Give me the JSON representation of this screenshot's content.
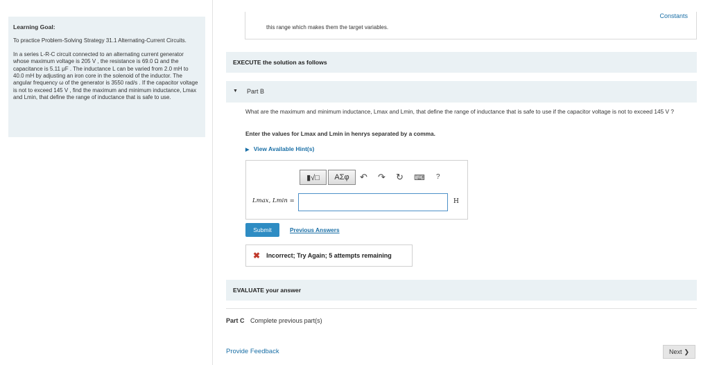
{
  "learning_goal": {
    "title": "Learning Goal:",
    "intro": "To practice Problem-Solving Strategy 31.1 Alternating-Current Circuits.",
    "body": "In a series L-R-C circuit connected to an alternating current generator whose maximum voltage is 205 V , the resistance is 69.0 Ω and the capacitance is 5.11 μF . The inductance L can be varied from 2.0 mH to 40.0 mH by adjusting an iron core in the solenoid of the inductor. The angular frequency ω of the generator is 3550 rad/s . If the capacitor voltage is not to exceed 145 V , find the maximum and minimum inductance, Lmax and Lmin, that define the range of inductance that is safe to use."
  },
  "header": {
    "constants_link": "Constants"
  },
  "top_box": {
    "text": "this range which makes them the target variables."
  },
  "execute": {
    "label": "EXECUTE the solution as follows"
  },
  "part_b": {
    "label": "Part B",
    "question": "What are the maximum and minimum inductance, Lmax and Lmin, that define the range of inductance that is safe to use if the capacitor voltage is not to exceed 145 V ?",
    "instruction": "Enter the values for Lmax and Lmin in henrys separated by a comma.",
    "hint_link": "View Available Hint(s)",
    "toolbar": {
      "templates": "▮√□",
      "greek": "ΑΣφ",
      "help": "?"
    },
    "equation_label": "Lmax, Lmin =",
    "answer_value": "",
    "unit": "H",
    "submit_label": "Submit",
    "previous_answers": "Previous Answers",
    "feedback": "Incorrect; Try Again; 5 attempts remaining"
  },
  "evaluate": {
    "label": "EVALUATE your answer"
  },
  "part_c": {
    "label": "Part C",
    "text": "Complete previous part(s)"
  },
  "footer": {
    "provide_feedback": "Provide Feedback",
    "next_label": "Next"
  },
  "colors": {
    "panel_bg": "#eaf1f4",
    "link": "#1a6fa6",
    "submit_bg": "#2e8cc3",
    "error": "#c0392b"
  }
}
